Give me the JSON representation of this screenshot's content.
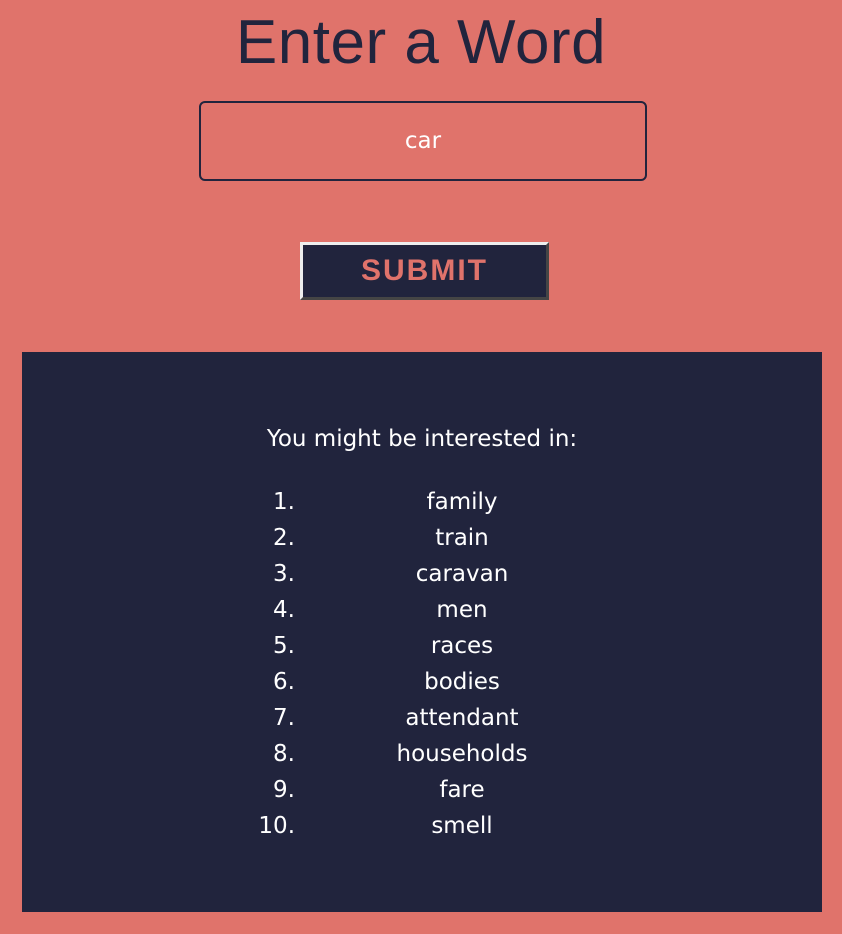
{
  "title": "Enter a Word",
  "input": {
    "value": "car"
  },
  "submit_label": "SUBMIT",
  "results": {
    "intro": "You might be interested in:",
    "items": [
      {
        "num": "1.",
        "word": "family"
      },
      {
        "num": "2.",
        "word": "train"
      },
      {
        "num": "3.",
        "word": "caravan"
      },
      {
        "num": "4.",
        "word": "men"
      },
      {
        "num": "5.",
        "word": "races"
      },
      {
        "num": "6.",
        "word": "bodies"
      },
      {
        "num": "7.",
        "word": "attendant"
      },
      {
        "num": "8.",
        "word": "households"
      },
      {
        "num": "9.",
        "word": "fare"
      },
      {
        "num": "10.",
        "word": "smell"
      }
    ]
  },
  "colors": {
    "background": "#E0736B",
    "panel": "#21243D",
    "text": "#FFFFFF"
  }
}
